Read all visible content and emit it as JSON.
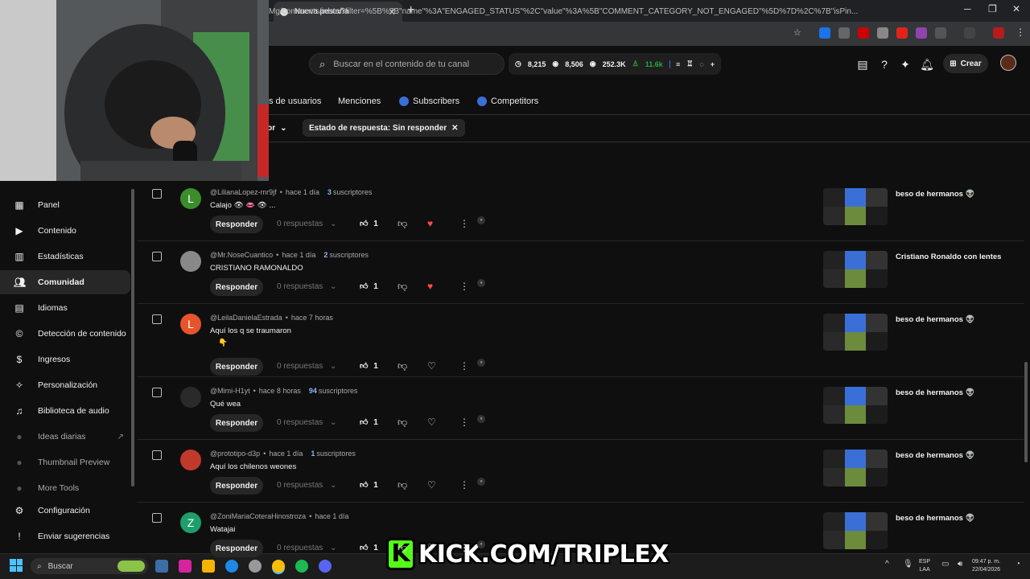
{
  "browser": {
    "tab_title": "Nueva pestaña",
    "url": "Mg/comments/inbox?filter=%5B%7B\"name\"%3A\"ENGAGED_STATUS\"%2C\"value\"%3A%5B\"COMMENT_CATEGORY_NOT_ENGAGED\"%5D%7D%2C%7B\"isPin..."
  },
  "topbar": {
    "search_placeholder": "Buscar en el contenido de tu canal",
    "stat1": "8,215",
    "stat2": "8,506",
    "stat3": "252.3K",
    "stat4": "11.6k",
    "create_label": "Crear"
  },
  "tabs": [
    {
      "label": "s de usuarios"
    },
    {
      "label": "Menciones"
    },
    {
      "label": "Subscribers"
    },
    {
      "label": "Competitors"
    }
  ],
  "filters": {
    "sort_label": "por",
    "status_chip": "Estado de respuesta: Sin responder"
  },
  "sidebar": {
    "items": [
      {
        "label": "Panel",
        "icon": "dashboard-icon"
      },
      {
        "label": "Contenido",
        "icon": "content-icon"
      },
      {
        "label": "Estadísticas",
        "icon": "analytics-icon"
      },
      {
        "label": "Comunidad",
        "icon": "community-icon"
      },
      {
        "label": "Idiomas",
        "icon": "subtitles-icon"
      },
      {
        "label": "Detección de contenido",
        "icon": "copyright-icon"
      },
      {
        "label": "Ingresos",
        "icon": "dollar-icon"
      },
      {
        "label": "Personalización",
        "icon": "wand-icon"
      },
      {
        "label": "Biblioteca de audio",
        "icon": "audio-library-icon"
      },
      {
        "label": "Ideas diarias",
        "icon": "extension-icon"
      },
      {
        "label": "Thumbnail Preview",
        "icon": "extension-icon"
      },
      {
        "label": "More Tools",
        "icon": "extension-icon"
      },
      {
        "label": "Configuración",
        "icon": "gear-icon"
      },
      {
        "label": "Enviar sugerencias",
        "icon": "feedback-icon"
      }
    ]
  },
  "comments": [
    {
      "initial": "L",
      "avatar_color": "#3b8d2c",
      "author": "@LilianaLopez-mr9jf",
      "time": "hace 1 día",
      "subs_num": "3",
      "subs_label": "suscriptores",
      "text": "Calajo 👁 👄 👁 ...",
      "reply": "Responder",
      "responses": "0 respuestas",
      "likes": "1",
      "video_title": "beso de hermanos 👽"
    },
    {
      "initial": "",
      "avatar_color": "#888888",
      "author": "@Mr.NoseCuantico",
      "time": "hace 1 día",
      "subs_num": "2",
      "subs_label": "suscriptores",
      "text": "CRISTIANO RAMONALDO",
      "reply": "Responder",
      "responses": "0 respuestas",
      "likes": "1",
      "video_title": "Cristiano Ronaldo con lentes"
    },
    {
      "initial": "L",
      "avatar_color": "#e5542a",
      "author": "@LeilaDanielaEstrada",
      "time": "hace 7 horas",
      "subs_num": "",
      "subs_label": "",
      "text": "Aquí los q se traumaron",
      "text2": "👇",
      "reply": "Responder",
      "responses": "0 respuestas",
      "likes": "1",
      "video_title": "beso de hermanos 👽"
    },
    {
      "initial": "",
      "avatar_color": "#2a2a2a",
      "author": "@Mimi-H1yt",
      "time": "hace 8 horas",
      "subs_num": "94",
      "subs_label": "suscriptores",
      "text": "Qué wea",
      "reply": "Responder",
      "responses": "0 respuestas",
      "likes": "1",
      "video_title": "beso de hermanos 👽"
    },
    {
      "initial": "",
      "avatar_color": "#c0392b",
      "author": "@prototipo-d3p",
      "time": "hace 1 día",
      "subs_num": "1",
      "subs_label": "suscriptores",
      "text": "Aquí los chilenos weones",
      "reply": "Responder",
      "responses": "0 respuestas",
      "likes": "1",
      "video_title": "beso de hermanos 👽"
    },
    {
      "initial": "Z",
      "avatar_color": "#1e9e6a",
      "author": "@ZoniMariaCoteraHinostroza",
      "time": "hace 1 día",
      "subs_num": "",
      "subs_label": "",
      "text": "Watajai",
      "reply": "Responder",
      "responses": "0 respuestas",
      "likes": "1",
      "video_title": "beso de hermanos 👽"
    }
  ],
  "taskbar": {
    "search_placeholder": "Buscar",
    "lang1": "ESP",
    "lang2": "LAA",
    "time": "09:47 p. m.",
    "date": "22/04/2026"
  },
  "overlay": {
    "kick_text": "KICK.COM/TRIPLEX"
  },
  "colors": {
    "accent_blue": "#3b6fd8",
    "kick_green": "#53fc18",
    "subs_blue": "#8ab4f8"
  }
}
